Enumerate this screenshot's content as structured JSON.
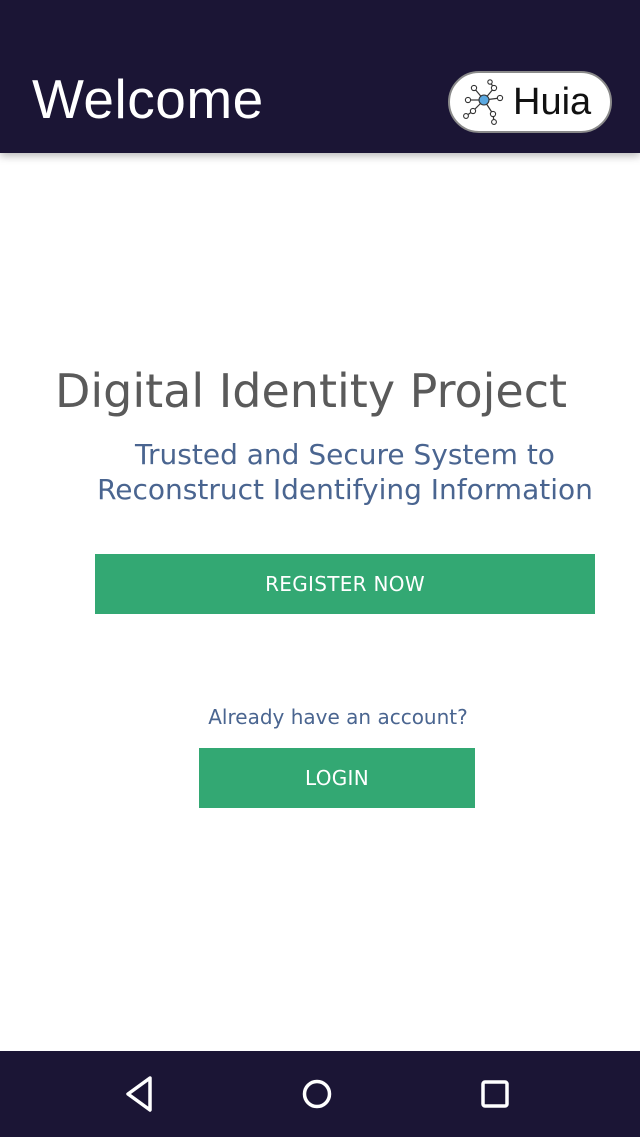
{
  "header": {
    "title": "Welcome",
    "brand": {
      "name": "Huia",
      "icon": "network-logo-icon"
    }
  },
  "main": {
    "heading": "Digital Identity Project",
    "subtitle": "Trusted and Secure System to Reconstruct Identifying Information",
    "register_button": "REGISTER NOW",
    "account_prompt": "Already have an account?",
    "login_button": "LOGIN"
  },
  "navigation": {
    "back_icon": "back-triangle-icon",
    "home_icon": "home-circle-icon",
    "recents_icon": "recents-square-icon"
  },
  "colors": {
    "bar_background": "#1b1535",
    "button_green": "#33a873",
    "heading_gray": "#5a5a5a",
    "subtitle_blue": "#4a6590"
  }
}
